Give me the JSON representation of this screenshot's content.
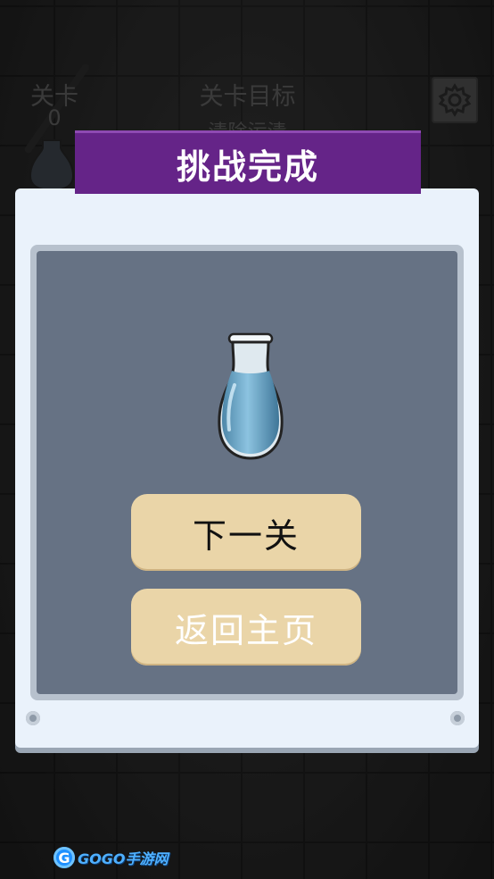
{
  "hud": {
    "level_label": "关卡",
    "level_value": "0",
    "goal_label": "关卡目标",
    "goal_text": "清除污渍"
  },
  "dialog": {
    "title": "挑战完成",
    "reward_icon": "water-bottle-icon",
    "next_button": "下一关",
    "home_button": "返回主页"
  },
  "watermark": {
    "text": "GOGO手游网"
  },
  "colors": {
    "banner": "#652488",
    "panel": "#667284",
    "button": "#ead5a8",
    "dialog": "#eaf2fb"
  }
}
